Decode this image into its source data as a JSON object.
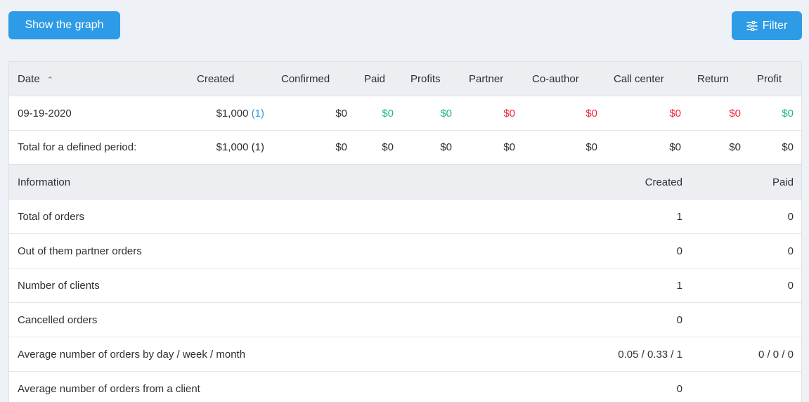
{
  "toolbar": {
    "graph_label": "Show the graph",
    "filter_label": "Filter"
  },
  "report": {
    "columns": {
      "date": "Date",
      "created": "Created",
      "confirmed": "Confirmed",
      "paid": "Paid",
      "profits": "Profits",
      "partner": "Partner",
      "coauthor": "Co-author",
      "callcenter": "Call center",
      "return": "Return",
      "profit": "Profit"
    },
    "rows": [
      {
        "date": "09-19-2020",
        "created": "$1,000",
        "created_count": "(1)",
        "confirmed": "$0",
        "paid": "$0",
        "profits": "$0",
        "partner": "$0",
        "coauthor": "$0",
        "callcenter": "$0",
        "return": "$0",
        "profit": "$0"
      }
    ],
    "total": {
      "label": "Total for a defined period:",
      "created": "$1,000 (1)",
      "confirmed": "$0",
      "paid": "$0",
      "profits": "$0",
      "partner": "$0",
      "coauthor": "$0",
      "callcenter": "$0",
      "return": "$0",
      "profit": "$0"
    }
  },
  "info": {
    "columns": {
      "information": "Information",
      "created": "Created",
      "paid": "Paid"
    },
    "rows": [
      {
        "label": "Total of orders",
        "created": "1",
        "paid": "0"
      },
      {
        "label": "Out of them partner orders",
        "created": "0",
        "paid": "0"
      },
      {
        "label": "Number of clients",
        "created": "1",
        "paid": "0"
      },
      {
        "label": "Cancelled orders",
        "created": "0",
        "paid": ""
      },
      {
        "label": "Average number of orders by day / week / month",
        "created": "0.05 / 0.33 / 1",
        "paid": "0 / 0 / 0"
      },
      {
        "label": "Average number of orders from a client",
        "created": "0",
        "paid": ""
      }
    ]
  },
  "colors": {
    "accent": "#2e9be6",
    "positive": "#1fb48d",
    "negative": "#ec2a3c"
  }
}
